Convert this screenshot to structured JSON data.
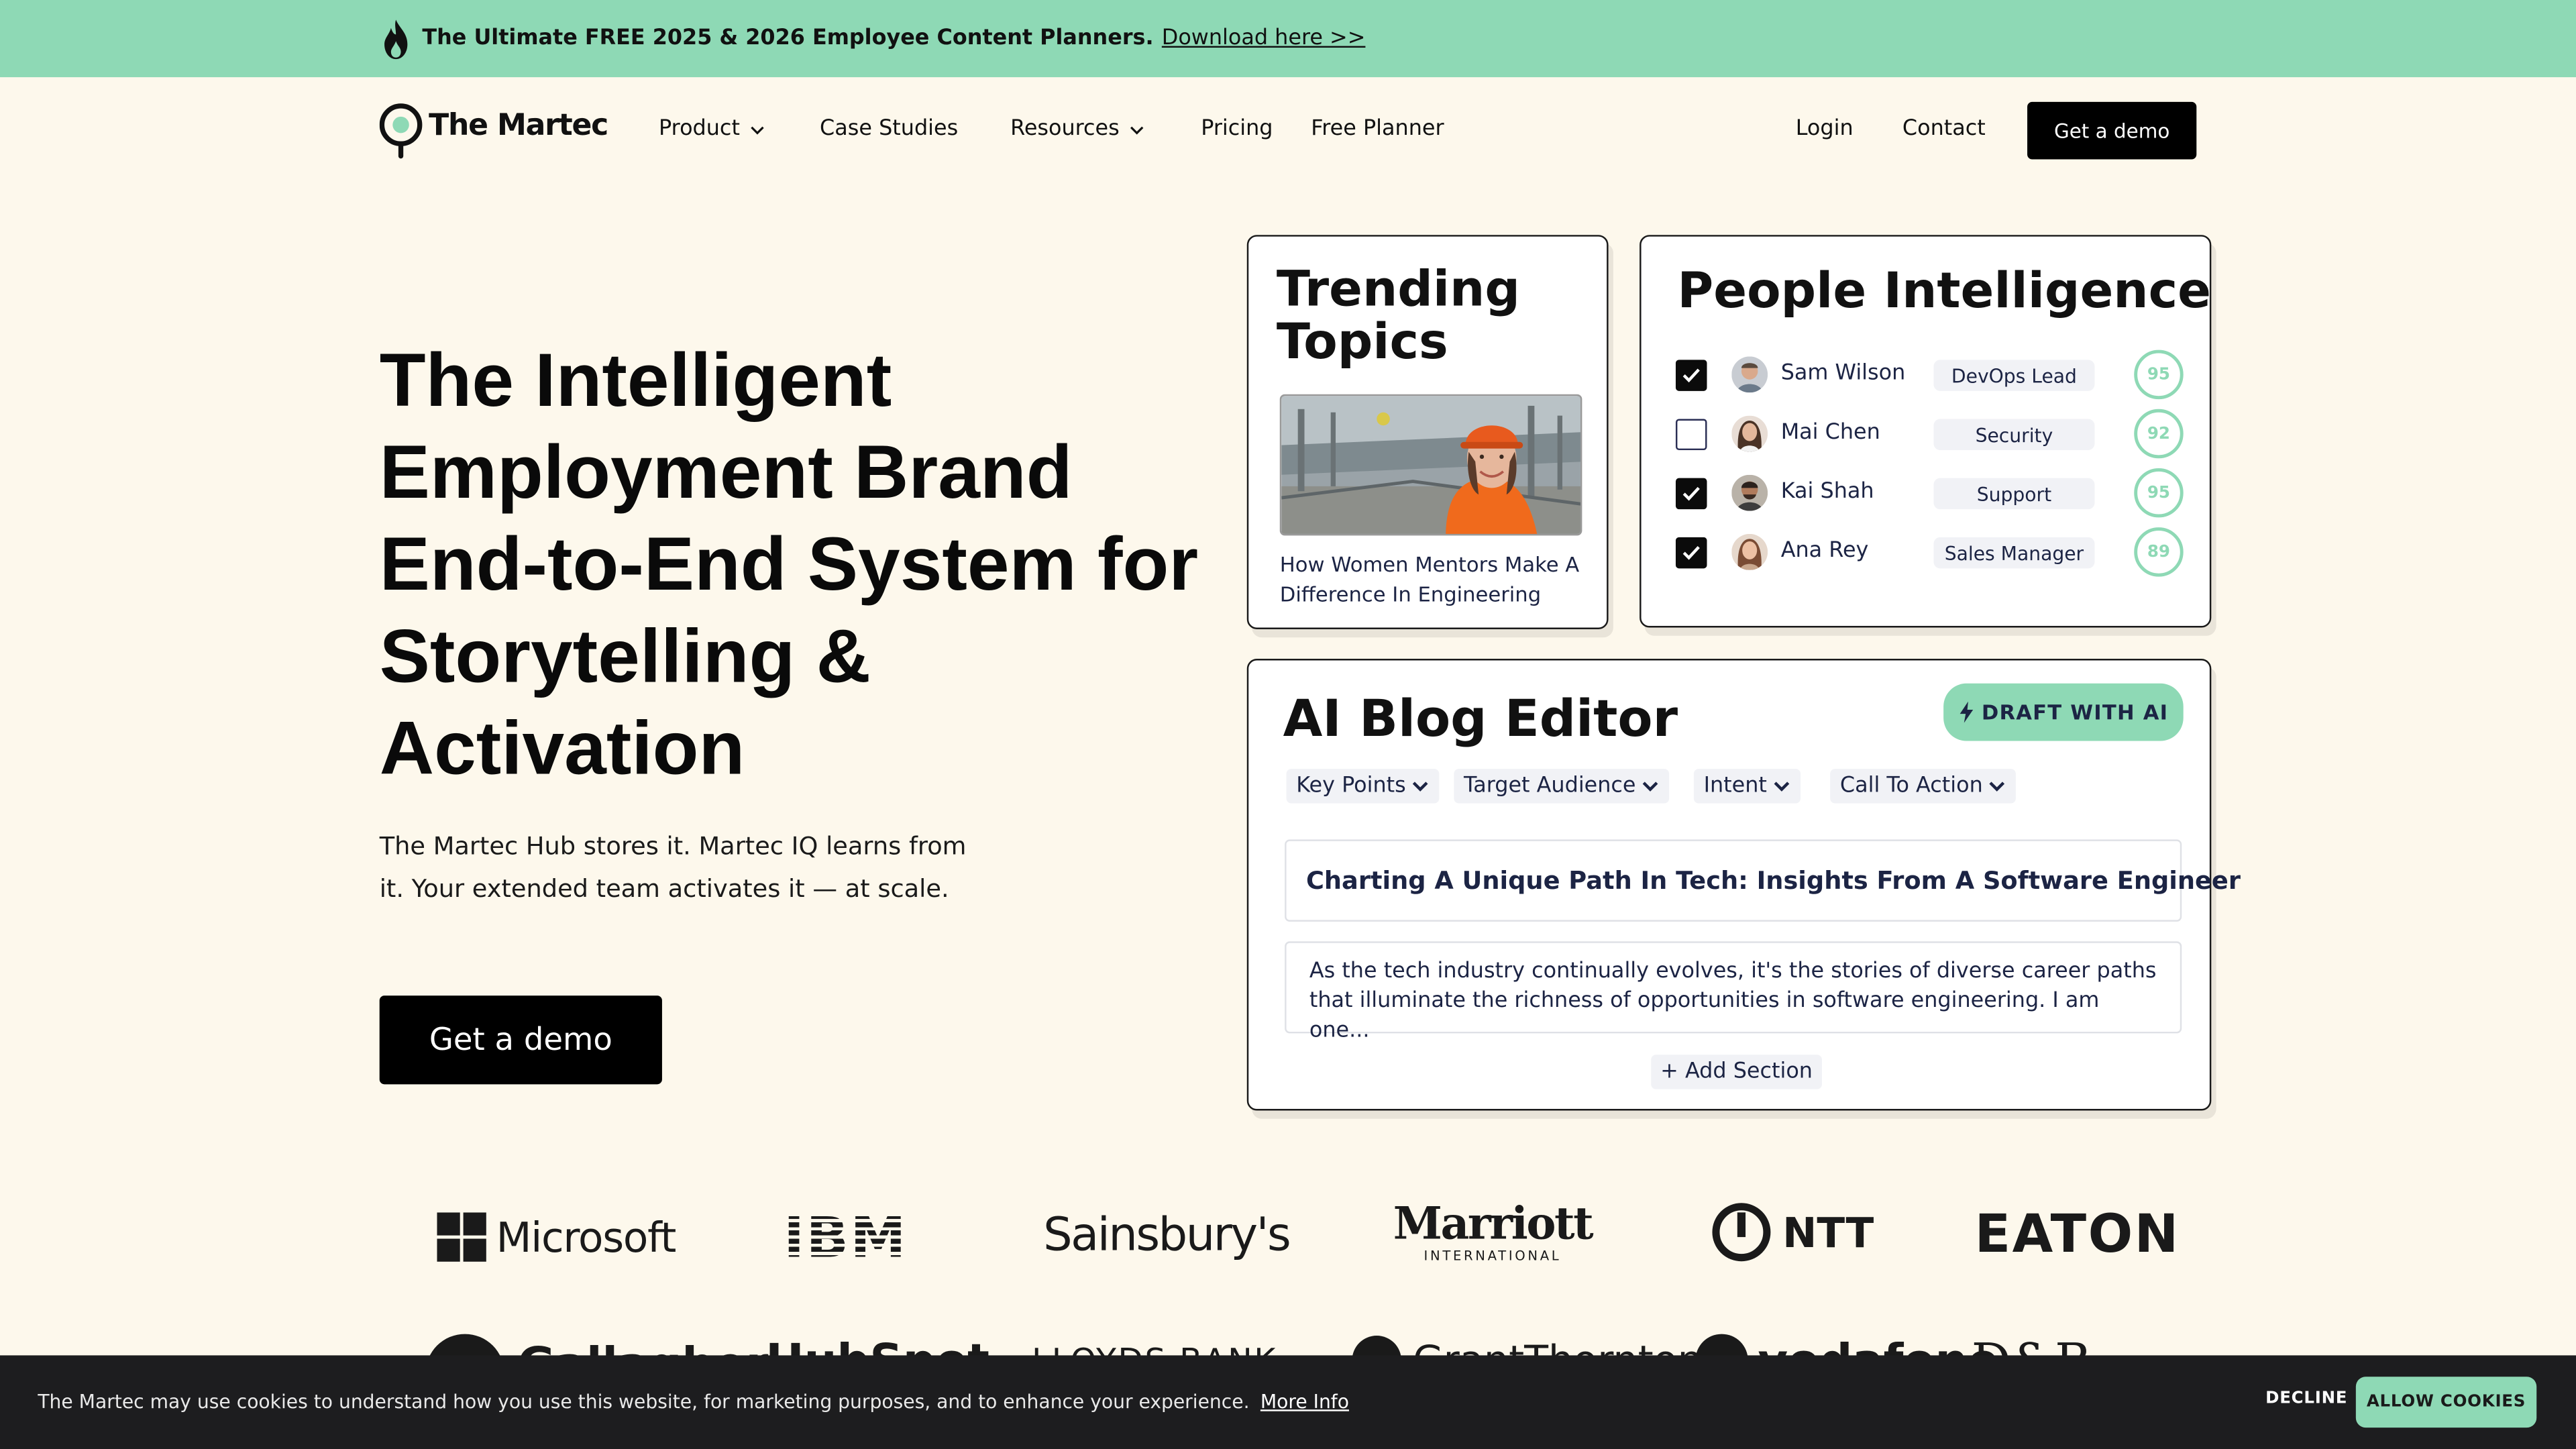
{
  "banner": {
    "text": "The Ultimate FREE 2025 & 2026 Employee Content Planners.",
    "link": "Download here >>"
  },
  "nav": {
    "logo": "The Martec",
    "items": [
      {
        "label": "Product",
        "dropdown": true
      },
      {
        "label": "Case Studies",
        "dropdown": false
      },
      {
        "label": "Resources",
        "dropdown": true
      },
      {
        "label": "Pricing",
        "dropdown": false
      },
      {
        "label": "Free Planner",
        "dropdown": false
      }
    ],
    "login": "Login",
    "contact": "Contact",
    "cta": "Get a demo"
  },
  "hero": {
    "title_lines": [
      "The Intelligent",
      "Employment Brand",
      "End-to-End System for",
      "Storytelling &",
      "Activation"
    ],
    "subtitle": "The Martec Hub stores it. Martec IQ learns from it. Your extended team activates it — at scale.",
    "cta": "Get a demo"
  },
  "trending": {
    "title": "Trending Topics",
    "caption": "How Women Mentors Make A Difference In Engineering"
  },
  "people": {
    "title": "People Intelligence",
    "rows": [
      {
        "name": "Sam Wilson",
        "role": "DevOps Lead",
        "score": "95",
        "checked": true
      },
      {
        "name": "Mai Chen",
        "role": "Security",
        "score": "92",
        "checked": false
      },
      {
        "name": "Kai Shah",
        "role": "Support",
        "score": "95",
        "checked": true
      },
      {
        "name": "Ana Rey",
        "role": "Sales Manager",
        "score": "89",
        "checked": true
      }
    ]
  },
  "blog": {
    "title": "AI Blog Editor",
    "draft_button": "DRAFT WITH AI",
    "chips": [
      "Key Points",
      "Target Audience",
      "Intent",
      "Call To Action"
    ],
    "post_title": "Charting A Unique Path In Tech: Insights From A Software Engineer",
    "post_body": "As the tech industry continually evolves, it's the stories of diverse career paths that illuminate the richness of opportunities in software engineering. I am one...",
    "add_section": "+ Add Section"
  },
  "logos": {
    "row1": [
      "Microsoft",
      "IBM",
      "Sainsbury's",
      "Marriott",
      "INTERNATIONAL",
      "NTT",
      "EATON"
    ],
    "row2": [
      "Gallagher",
      "HubSpot",
      "LLOYDS BANK",
      "GrantThornton",
      "vodafone",
      "D&B"
    ]
  },
  "cookie": {
    "text": "The Martec may use cookies to understand how you use this website, for marketing purposes, and to enhance your experience.",
    "more": "More Info",
    "decline": "DECLINE",
    "allow": "ALLOW COOKIES"
  },
  "colors": {
    "accent": "#8ed9b5",
    "background": "#fdf8ec",
    "navy": "#1c2444"
  }
}
